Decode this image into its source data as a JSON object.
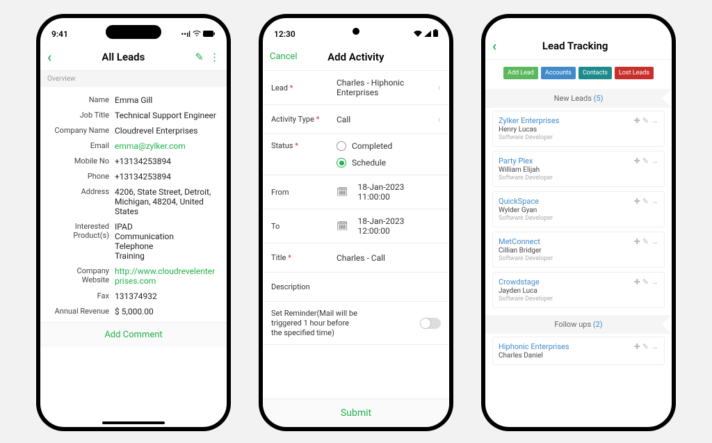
{
  "p1": {
    "status_time": "9:41",
    "title": "All Leads",
    "overview_label": "Overview",
    "fields": {
      "name_l": "Name",
      "name_v": "Emma Gill",
      "job_l": "Job Title",
      "job_v": "Technical Support Engineer",
      "comp_l": "Company Name",
      "comp_v": "Cloudrevel Enterprises",
      "email_l": "Email",
      "email_v": "emma@zylker.com",
      "mob_l": "Mobile No",
      "mob_v": "+13134253894",
      "phone_l": "Phone",
      "phone_v": "+13134253894",
      "addr_l": "Address",
      "addr_v": "4206, State Street, Detroit, Michigan, 48204, United States",
      "prod_l": "Interested Product(s)",
      "prod_v": "IPAD\nCommunication\nTelephone\nTraining",
      "web_l": "Company Website",
      "web_v": "http://www.cloudrevelenterprises.com",
      "fax_l": "Fax",
      "fax_v": "131374932",
      "rev_l": "Annual Revenue",
      "rev_v": "$ 5,000.00"
    },
    "add_comment": "Add Comment"
  },
  "p2": {
    "status_time": "12:30",
    "cancel": "Cancel",
    "title": "Add Activity",
    "lead_l": "Lead",
    "lead_v": "Charles - Hiphonic Enterprises",
    "type_l": "Activity Type",
    "type_v": "Call",
    "status_l": "Status",
    "status_opt1": "Completed",
    "status_opt2": "Schedule",
    "from_l": "From",
    "from_v1": "18-Jan-2023",
    "from_v2": "11:00:00",
    "to_l": "To",
    "to_v1": "18-Jan-2023",
    "to_v2": "12:00:00",
    "title_l": "Title",
    "title_v": "Charles - Call",
    "desc_l": "Description",
    "reminder_l": "Set Reminder(Mail will be triggered 1 hour before the specified time)",
    "submit": "Submit"
  },
  "p3": {
    "title": "Lead Tracking",
    "btn_add": "Add Lead",
    "btn_acc": "Accounts",
    "btn_con": "Contacts",
    "btn_lost": "Lost Leads",
    "sec1_label": "New Leads ",
    "sec1_count": "(5)",
    "sec2_label": "Follow ups ",
    "sec2_count": "(2)",
    "leads": [
      {
        "company": "Zylker Enterprises",
        "contact": "Henry   Lucas",
        "role": "Software Developer"
      },
      {
        "company": "Party Plex",
        "contact": "William   Elijah",
        "role": "Software Developer"
      },
      {
        "company": "QuickSpace",
        "contact": "Wylder   Gyan",
        "role": "Software Developer"
      },
      {
        "company": "MetConnect",
        "contact": "Cillian   Bridger",
        "role": "Software Developer"
      },
      {
        "company": "Crowdstage",
        "contact": "Jayden   Luca",
        "role": "Software Developer"
      }
    ],
    "followups": [
      {
        "company": "Hiphonic Enterprises",
        "contact": "Charles   Daniel",
        "role": ""
      }
    ]
  }
}
